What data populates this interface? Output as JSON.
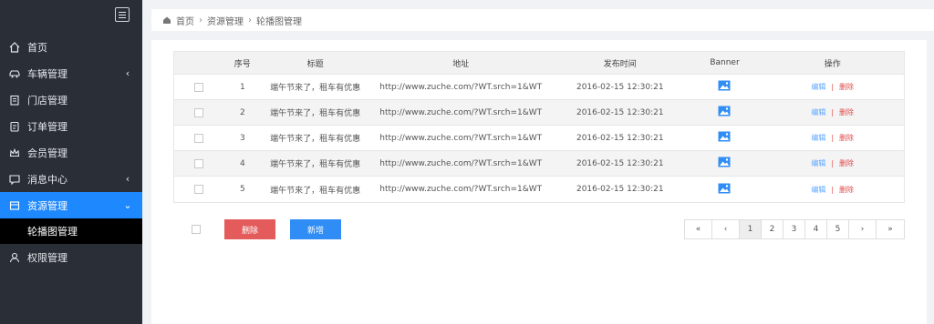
{
  "sidebar": {
    "items": [
      {
        "label": "首页",
        "icon": "home-icon",
        "has_chevron": false
      },
      {
        "label": "车辆管理",
        "icon": "car-icon",
        "has_chevron": true,
        "chevron": "‹"
      },
      {
        "label": "门店管理",
        "icon": "store-icon",
        "has_chevron": false
      },
      {
        "label": "订单管理",
        "icon": "order-icon",
        "has_chevron": false
      },
      {
        "label": "会员管理",
        "icon": "crown-icon",
        "has_chevron": false
      },
      {
        "label": "消息中心",
        "icon": "message-icon",
        "has_chevron": true,
        "chevron": "‹"
      },
      {
        "label": "资源管理",
        "icon": "resource-icon",
        "has_chevron": true,
        "chevron": "⌄",
        "active": true
      },
      {
        "label": "权限管理",
        "icon": "user-icon",
        "has_chevron": false
      }
    ],
    "subitem": {
      "label": "轮播图管理"
    }
  },
  "breadcrumb": {
    "home": "首页",
    "parent": "资源管理",
    "current": "轮播图管理"
  },
  "table": {
    "headers": {
      "index": "序号",
      "title": "标题",
      "url": "地址",
      "time": "发布时间",
      "banner": "Banner",
      "ops": "操作"
    },
    "rows": [
      {
        "index": "1",
        "title": "端午节来了，租车有优惠",
        "url": "http://www.zuche.com/?WT.srch=1&WT",
        "time": "2016-02-15 12:30:21",
        "edit": "编辑",
        "sep": "|",
        "del": "删除"
      },
      {
        "index": "2",
        "title": "端午节来了，租车有优惠",
        "url": "http://www.zuche.com/?WT.srch=1&WT",
        "time": "2016-02-15 12:30:21",
        "edit": "编辑",
        "sep": "|",
        "del": "删除"
      },
      {
        "index": "3",
        "title": "端午节来了，租车有优惠",
        "url": "http://www.zuche.com/?WT.srch=1&WT",
        "time": "2016-02-15 12:30:21",
        "edit": "编辑",
        "sep": "|",
        "del": "删除"
      },
      {
        "index": "4",
        "title": "端午节来了，租车有优惠",
        "url": "http://www.zuche.com/?WT.srch=1&WT",
        "time": "2016-02-15 12:30:21",
        "edit": "编辑",
        "sep": "|",
        "del": "删除"
      },
      {
        "index": "5",
        "title": "端午节来了，租车有优惠",
        "url": "http://www.zuche.com/?WT.srch=1&WT",
        "time": "2016-02-15 12:30:21",
        "edit": "编辑",
        "sep": "|",
        "del": "删除"
      }
    ]
  },
  "actions": {
    "delete_label": "删除",
    "add_label": "新增"
  },
  "pagination": {
    "first": "«",
    "prev": "‹",
    "pages": [
      "1",
      "2",
      "3",
      "4",
      "5"
    ],
    "current": "1",
    "next": "›",
    "last": "»"
  },
  "colors": {
    "sidebar_bg": "#2a2e37",
    "active_blue": "#1e88ff",
    "delete_red": "#e35b5b",
    "add_blue": "#2f8df5",
    "link_blue": "#5ba5ff"
  }
}
